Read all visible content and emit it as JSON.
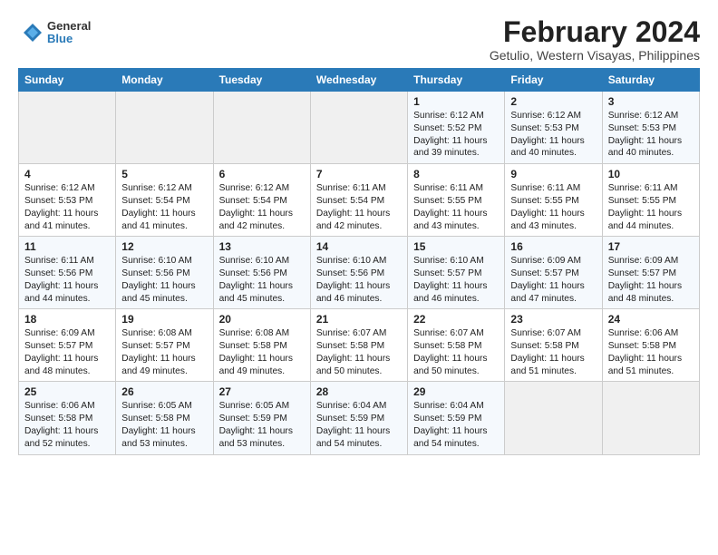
{
  "logo": {
    "line1": "General",
    "line2": "Blue"
  },
  "title": "February 2024",
  "subtitle": "Getulio, Western Visayas, Philippines",
  "header_days": [
    "Sunday",
    "Monday",
    "Tuesday",
    "Wednesday",
    "Thursday",
    "Friday",
    "Saturday"
  ],
  "weeks": [
    [
      {
        "day": "",
        "text": ""
      },
      {
        "day": "",
        "text": ""
      },
      {
        "day": "",
        "text": ""
      },
      {
        "day": "",
        "text": ""
      },
      {
        "day": "1",
        "text": "Sunrise: 6:12 AM\nSunset: 5:52 PM\nDaylight: 11 hours\nand 39 minutes."
      },
      {
        "day": "2",
        "text": "Sunrise: 6:12 AM\nSunset: 5:53 PM\nDaylight: 11 hours\nand 40 minutes."
      },
      {
        "day": "3",
        "text": "Sunrise: 6:12 AM\nSunset: 5:53 PM\nDaylight: 11 hours\nand 40 minutes."
      }
    ],
    [
      {
        "day": "4",
        "text": "Sunrise: 6:12 AM\nSunset: 5:53 PM\nDaylight: 11 hours\nand 41 minutes."
      },
      {
        "day": "5",
        "text": "Sunrise: 6:12 AM\nSunset: 5:54 PM\nDaylight: 11 hours\nand 41 minutes."
      },
      {
        "day": "6",
        "text": "Sunrise: 6:12 AM\nSunset: 5:54 PM\nDaylight: 11 hours\nand 42 minutes."
      },
      {
        "day": "7",
        "text": "Sunrise: 6:11 AM\nSunset: 5:54 PM\nDaylight: 11 hours\nand 42 minutes."
      },
      {
        "day": "8",
        "text": "Sunrise: 6:11 AM\nSunset: 5:55 PM\nDaylight: 11 hours\nand 43 minutes."
      },
      {
        "day": "9",
        "text": "Sunrise: 6:11 AM\nSunset: 5:55 PM\nDaylight: 11 hours\nand 43 minutes."
      },
      {
        "day": "10",
        "text": "Sunrise: 6:11 AM\nSunset: 5:55 PM\nDaylight: 11 hours\nand 44 minutes."
      }
    ],
    [
      {
        "day": "11",
        "text": "Sunrise: 6:11 AM\nSunset: 5:56 PM\nDaylight: 11 hours\nand 44 minutes."
      },
      {
        "day": "12",
        "text": "Sunrise: 6:10 AM\nSunset: 5:56 PM\nDaylight: 11 hours\nand 45 minutes."
      },
      {
        "day": "13",
        "text": "Sunrise: 6:10 AM\nSunset: 5:56 PM\nDaylight: 11 hours\nand 45 minutes."
      },
      {
        "day": "14",
        "text": "Sunrise: 6:10 AM\nSunset: 5:56 PM\nDaylight: 11 hours\nand 46 minutes."
      },
      {
        "day": "15",
        "text": "Sunrise: 6:10 AM\nSunset: 5:57 PM\nDaylight: 11 hours\nand 46 minutes."
      },
      {
        "day": "16",
        "text": "Sunrise: 6:09 AM\nSunset: 5:57 PM\nDaylight: 11 hours\nand 47 minutes."
      },
      {
        "day": "17",
        "text": "Sunrise: 6:09 AM\nSunset: 5:57 PM\nDaylight: 11 hours\nand 48 minutes."
      }
    ],
    [
      {
        "day": "18",
        "text": "Sunrise: 6:09 AM\nSunset: 5:57 PM\nDaylight: 11 hours\nand 48 minutes."
      },
      {
        "day": "19",
        "text": "Sunrise: 6:08 AM\nSunset: 5:57 PM\nDaylight: 11 hours\nand 49 minutes."
      },
      {
        "day": "20",
        "text": "Sunrise: 6:08 AM\nSunset: 5:58 PM\nDaylight: 11 hours\nand 49 minutes."
      },
      {
        "day": "21",
        "text": "Sunrise: 6:07 AM\nSunset: 5:58 PM\nDaylight: 11 hours\nand 50 minutes."
      },
      {
        "day": "22",
        "text": "Sunrise: 6:07 AM\nSunset: 5:58 PM\nDaylight: 11 hours\nand 50 minutes."
      },
      {
        "day": "23",
        "text": "Sunrise: 6:07 AM\nSunset: 5:58 PM\nDaylight: 11 hours\nand 51 minutes."
      },
      {
        "day": "24",
        "text": "Sunrise: 6:06 AM\nSunset: 5:58 PM\nDaylight: 11 hours\nand 51 minutes."
      }
    ],
    [
      {
        "day": "25",
        "text": "Sunrise: 6:06 AM\nSunset: 5:58 PM\nDaylight: 11 hours\nand 52 minutes."
      },
      {
        "day": "26",
        "text": "Sunrise: 6:05 AM\nSunset: 5:58 PM\nDaylight: 11 hours\nand 53 minutes."
      },
      {
        "day": "27",
        "text": "Sunrise: 6:05 AM\nSunset: 5:59 PM\nDaylight: 11 hours\nand 53 minutes."
      },
      {
        "day": "28",
        "text": "Sunrise: 6:04 AM\nSunset: 5:59 PM\nDaylight: 11 hours\nand 54 minutes."
      },
      {
        "day": "29",
        "text": "Sunrise: 6:04 AM\nSunset: 5:59 PM\nDaylight: 11 hours\nand 54 minutes."
      },
      {
        "day": "",
        "text": ""
      },
      {
        "day": "",
        "text": ""
      }
    ]
  ]
}
